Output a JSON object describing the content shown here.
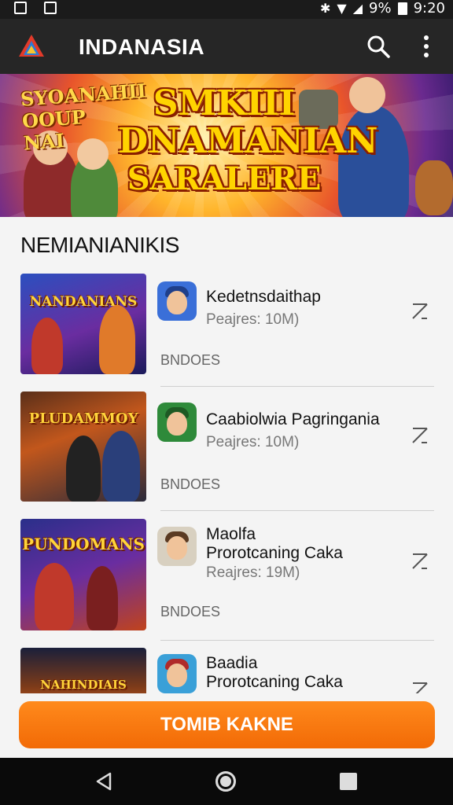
{
  "status_bar": {
    "left_icons": [
      "image-icon",
      "gallery-icon"
    ],
    "right_icons": [
      "bluetooth-icon",
      "wifi-icon",
      "signal-icon"
    ],
    "battery_text": "9%",
    "time": "9:20"
  },
  "app_bar": {
    "title": "INDANASIA",
    "icons": [
      "app-logo",
      "search-icon",
      "more-vert-icon"
    ]
  },
  "banner": {
    "tagline": "SYOANAHII OOUP NAI",
    "title_line1": "SMKIII",
    "title_line2": "DNAMANIAN",
    "title_line3": "SARALERE"
  },
  "section": {
    "title": "NEMIANIANIKIS"
  },
  "items": [
    {
      "thumb_title": "NANDANIANS",
      "title_lines": [
        "Kedetnsdaithap"
      ],
      "subtitle": "Peajres: 10M)",
      "tag": "BNDOES"
    },
    {
      "thumb_title": "PLUDAMMOY",
      "title_lines": [
        "Caabiolwia Pagringania"
      ],
      "subtitle": "Peajres: 10M)",
      "tag": "BNDOES"
    },
    {
      "thumb_title": "PUNDOMANS",
      "title_lines": [
        "Maolfa",
        "Prorotcaning Caka"
      ],
      "subtitle": "Reajres: 19M)",
      "tag": "BNDOES"
    },
    {
      "thumb_title": "NAHINDIAIS",
      "title_lines": [
        "Baadia",
        "Prorotcaning Caka"
      ],
      "subtitle": "",
      "tag": ""
    }
  ],
  "cta": {
    "label": "TOMIB KAKNE"
  },
  "nav": {
    "icons": [
      "back-icon",
      "home-icon",
      "recents-icon"
    ]
  },
  "colors": {
    "accent": "#f5760e",
    "app_bar": "#262626",
    "background": "#f4f4f4"
  }
}
